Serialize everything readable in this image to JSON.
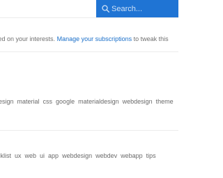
{
  "search": {
    "placeholder": "Search..."
  },
  "intro": {
    "text_before": "s based on your interests.",
    "link": "Manage your subscriptions",
    "text_after": "to tweak this"
  },
  "tag_rows": [
    {
      "tags": [
        "design",
        "material",
        "css",
        "google",
        "materialdesign",
        "webdesign",
        "theme"
      ]
    },
    {
      "tags": [
        "cklist",
        "ux",
        "web",
        "ui",
        "app",
        "webdesign",
        "webdev",
        "webapp",
        "tips"
      ]
    }
  ],
  "colors": {
    "search_bg": "#1f74d4",
    "link": "#1a6fc9",
    "text": "#707070"
  }
}
